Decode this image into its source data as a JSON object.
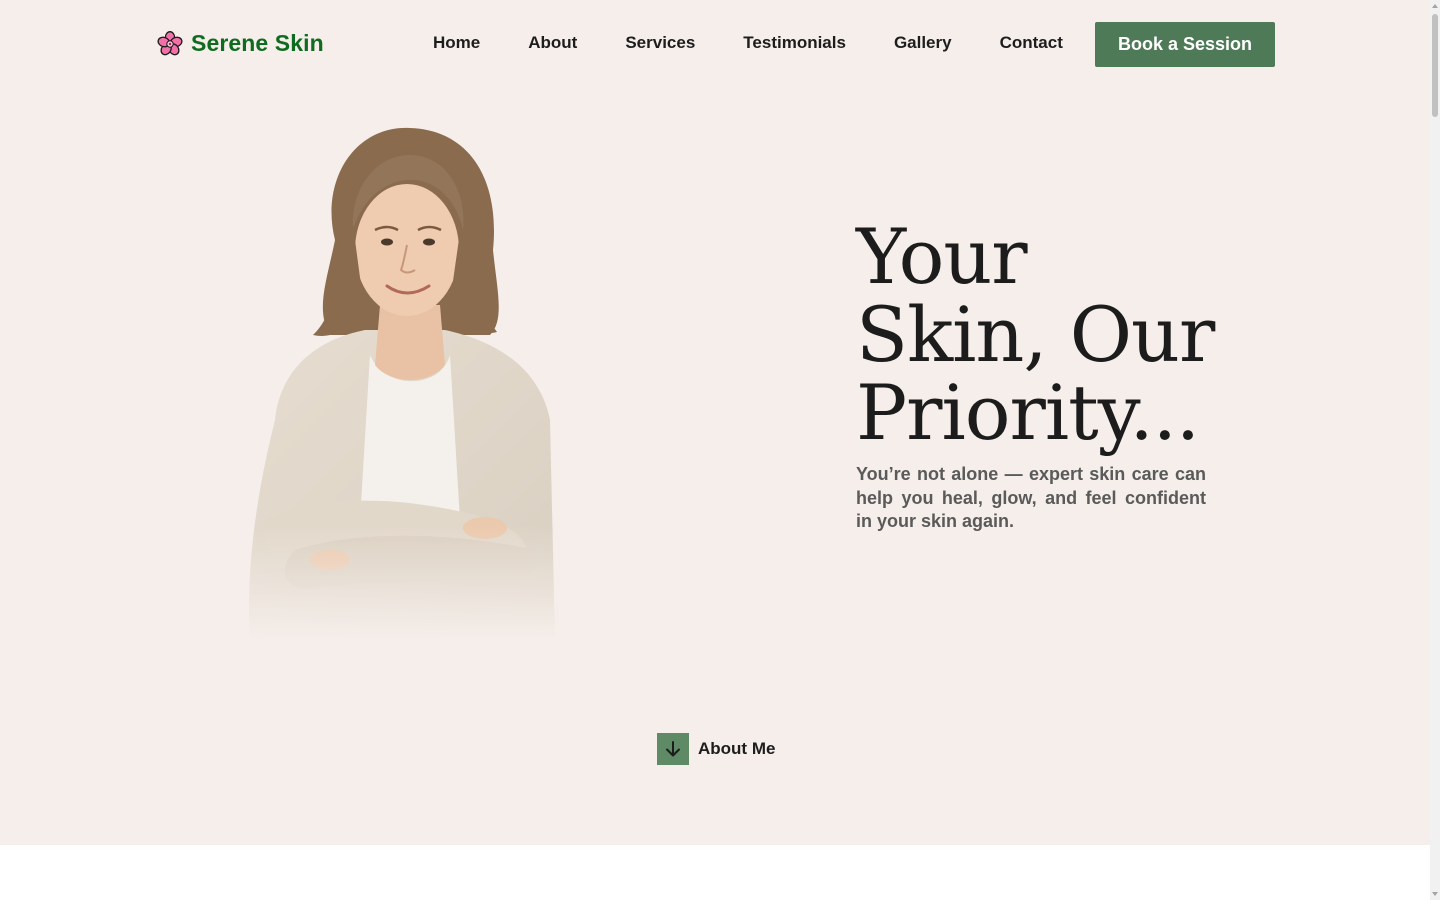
{
  "brand": {
    "name": "Serene Skin",
    "icon": "flower-icon",
    "color": "#0f6b1f"
  },
  "nav": {
    "items": [
      {
        "label": "Home"
      },
      {
        "label": "About"
      },
      {
        "label": "Services"
      },
      {
        "label": "Testimonials"
      },
      {
        "label": "Gallery"
      },
      {
        "label": "Contact"
      }
    ],
    "cta_label": "Book a Session"
  },
  "hero": {
    "headline": "Your Skin, Our Priority...",
    "subtext": "You’re not alone — expert skin care can help you heal, glow, and feel confident in your skin again.",
    "portrait": "woman-portrait-image"
  },
  "about_link": {
    "label": "About Me",
    "icon": "arrow-down-icon"
  },
  "colors": {
    "hero_background": "#f5eeea",
    "accent": "#4f7a58",
    "text": "#1c1c1c"
  }
}
